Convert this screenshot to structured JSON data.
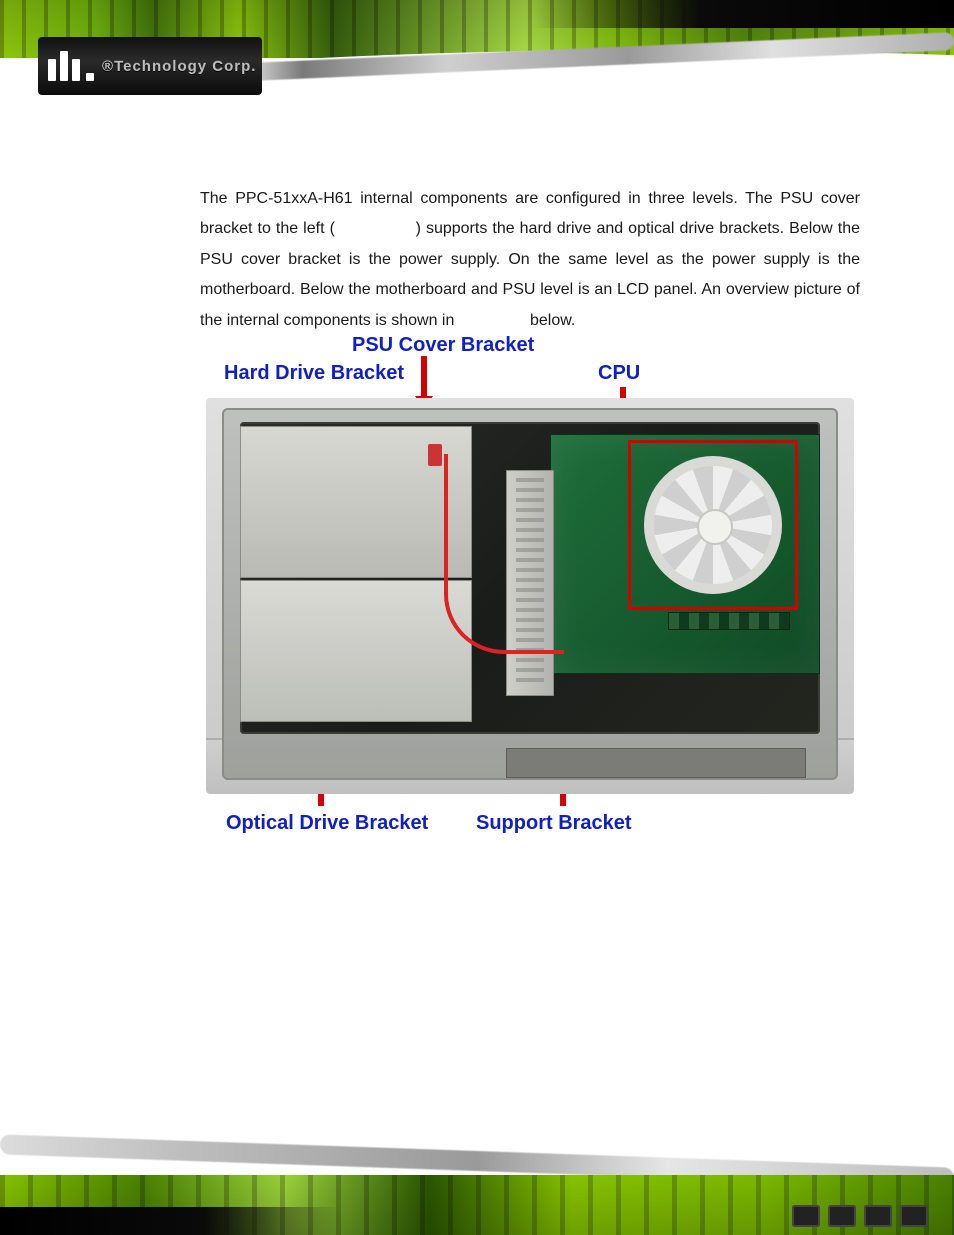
{
  "brand": {
    "reg": "®",
    "text": "Technology Corp."
  },
  "body": {
    "para_part1": "The PPC-51xxA-H61 internal components are configured in three levels. The PSU cover bracket to the left (",
    "para_part2": ") supports the hard drive and optical drive brackets. Below the PSU cover bracket is the power supply. On the same level as the power supply is the motherboard. Below the motherboard and PSU level is an LCD panel. An overview picture of the internal components is shown in",
    "para_part3": " below."
  },
  "figure": {
    "labels": {
      "psu": "PSU Cover Bracket",
      "hdd": "Hard Drive Bracket",
      "cpu": "CPU",
      "odd": "Optical Drive Bracket",
      "support": "Support Bracket"
    }
  }
}
